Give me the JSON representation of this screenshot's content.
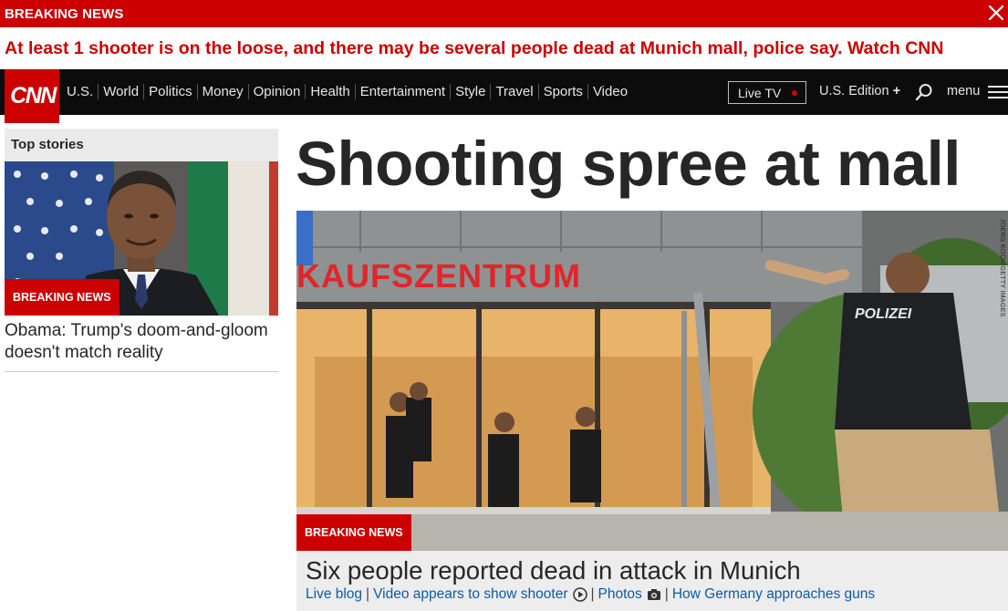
{
  "breaking_bar": {
    "label": "BREAKING NEWS",
    "message": "At least 1 shooter is on the loose, and there may be several people dead at Munich mall, police say. Watch CNN"
  },
  "nav": {
    "logo": "CNN",
    "links": [
      "U.S.",
      "World",
      "Politics",
      "Money",
      "Opinion",
      "Health",
      "Entertainment",
      "Style",
      "Travel",
      "Sports",
      "Video"
    ],
    "live_tv": "Live TV",
    "edition": "U.S. Edition",
    "edition_plus": "+",
    "menu": "menu"
  },
  "top_stories": {
    "header": "Top stories",
    "badge": "BREAKING NEWS",
    "headline": "Obama: Trump's doom-and-gloom doesn't match reality"
  },
  "main": {
    "headline": "Shooting spree at mall",
    "hero_sign": "KAUFSZENTRUM",
    "police_text": "POLIZEI",
    "photo_credit": "JOERG KOCH/GETTY IMAGES",
    "badge": "BREAKING NEWS",
    "caption_title": "Six people reported dead in attack in Munich",
    "links": {
      "live_blog": "Live blog",
      "video": "Video appears to show shooter",
      "photos": "Photos",
      "germany": "How Germany approaches guns"
    }
  },
  "colors": {
    "brand_red": "#cc0000",
    "nav_bg": "#0c0c0c",
    "link_blue": "#0c5aa8"
  }
}
